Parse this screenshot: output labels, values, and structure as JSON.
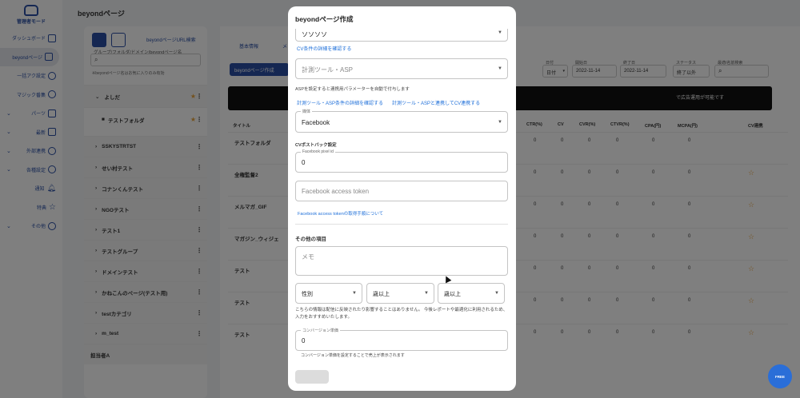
{
  "sidebar": {
    "logo_text": "管理者モード",
    "items": [
      {
        "label": "ダッシュボード",
        "icon": "home-icon"
      },
      {
        "label": "beyondページ",
        "icon": "document-icon",
        "active": true
      },
      {
        "label": "一括アク設定",
        "icon": "settings-icon"
      },
      {
        "label": "マジック番集",
        "icon": "magic-icon"
      },
      {
        "label": "パーツ",
        "icon": "parts-icon",
        "expandable": true
      },
      {
        "label": "最新",
        "icon": "grid-icon",
        "expandable": true
      },
      {
        "label": "外部連携",
        "icon": "link-icon",
        "expandable": true
      },
      {
        "label": "各種設定",
        "icon": "gear-icon",
        "expandable": true
      },
      {
        "label": "通知",
        "icon": "bell-icon"
      },
      {
        "label": "特典",
        "icon": "star-icon"
      },
      {
        "label": "その他",
        "icon": "info-icon",
        "expandable": true
      }
    ]
  },
  "page_title": "beyondページ",
  "list_panel": {
    "tab_label": "beyondページURL検索",
    "search_placeholder": "グループ/フォルダ/ドメイン/beyondページ名",
    "hint": "※beyondページ名はお気に入りのみ有効",
    "items": [
      {
        "label": "よしだ",
        "type": "group",
        "star": true
      },
      {
        "label": "テストフォルダ",
        "type": "folder",
        "star": true
      },
      {
        "label": "SSKYSTRTST",
        "type": "group"
      },
      {
        "label": "せい村テスト",
        "type": "group"
      },
      {
        "label": "コナンくんテスト",
        "type": "group"
      },
      {
        "label": "NGOテスト",
        "type": "group"
      },
      {
        "label": "テスト1",
        "type": "group"
      },
      {
        "label": "テストグループ",
        "type": "group"
      },
      {
        "label": "ドメインテスト",
        "type": "group"
      },
      {
        "label": "かねこんのページ(テスト用)",
        "type": "group"
      },
      {
        "label": "testカテゴリ",
        "type": "group"
      },
      {
        "label": "m_test",
        "type": "group"
      },
      {
        "label": "担当者A",
        "type": "group"
      }
    ]
  },
  "main": {
    "tabs": [
      "基本情報",
      "メ"
    ],
    "create_button": "beyondページ作成",
    "filters": [
      {
        "label": "日付",
        "value": "日付"
      },
      {
        "label": "開始日",
        "value": "2022-11-14"
      },
      {
        "label": "終了日",
        "value": "2022-11-14"
      },
      {
        "label": "ステータス",
        "value": "終了以外"
      },
      {
        "label": "最適/名前検索",
        "value": ""
      }
    ],
    "banner_text": "で広告運用が可能です",
    "columns": [
      "タイトル",
      "CTR(%)",
      "CV",
      "CVR(%)",
      "CTVR(%)",
      "CPA(円)",
      "MCPA(円)",
      "CV連携"
    ],
    "rows": [
      {
        "title": "テストフォルダ",
        "values": [
          "0",
          "0",
          "0",
          "0",
          "0",
          "0"
        ]
      },
      {
        "title": "全権監督2",
        "values": [
          "0",
          "0",
          "0",
          "0",
          "0",
          "0"
        ]
      },
      {
        "title": "メルマガ_GIF",
        "values": [
          "0",
          "0",
          "0",
          "0",
          "0",
          "0"
        ]
      },
      {
        "title": "マガジン_ウィジェ",
        "values": [
          "0",
          "0",
          "0",
          "0",
          "0",
          "0"
        ]
      },
      {
        "title": "テスト",
        "values": [
          "0",
          "0",
          "0",
          "0",
          "0",
          "0"
        ]
      },
      {
        "title": "テスト",
        "values": [
          "0",
          "0",
          "0",
          "0",
          "0",
          "0"
        ]
      },
      {
        "title": "テスト",
        "values": [
          "0",
          "0",
          "0",
          "0",
          "0",
          "0"
        ]
      }
    ]
  },
  "modal": {
    "title": "beyondページ作成",
    "top_select_value": "ソソソソ",
    "cv_link": "CV条件の詳細を確認する",
    "asp_placeholder": "計測ツール・ASP",
    "asp_note": "ASPを設定すると連携用パラメーターを自動で付与します",
    "asp_link1": "計測ツール・ASP条件の詳細を確認する",
    "asp_link2": "計測ツール・ASPと連携してCV連携する",
    "media_label": "媒体",
    "media_value": "Facebook",
    "cv_postback_section": "CVポストバック設定",
    "pixel_label": "Facebook pixel id",
    "pixel_value": "0",
    "token_placeholder": "Facebook access token",
    "token_link": "Facebook access tokenの取得手順について",
    "other_section": "その他の項目",
    "memo_placeholder": "メモ",
    "gender_value": "性別",
    "age_from_value": "歳以上",
    "age_to_value": "歳以上",
    "info_note": "こちらの情報は配信に反映されたり影響することはありません。 今後レポートや最適化に利用されるため、入力をおすすめいたします。",
    "conversion_label": "コンバージョン単価",
    "conversion_value": "0",
    "conversion_note": "コンバージョン単価を設定することで売上が表示されます"
  },
  "chat": {
    "label": "FREE"
  }
}
